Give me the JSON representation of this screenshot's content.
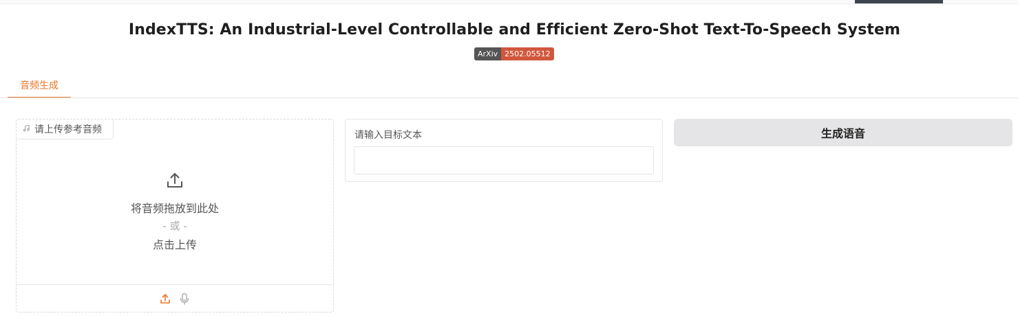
{
  "header": {
    "title": "IndexTTS: An Industrial-Level Controllable and Efficient Zero-Shot Text-To-Speech System",
    "badge_left": "ArXiv",
    "badge_right": "2502.05512"
  },
  "tabs": [
    {
      "label": "音频生成",
      "active": true
    }
  ],
  "audio_upload": {
    "label": "请上传参考音频",
    "drop_text": "将音频拖放到此处",
    "or_text": "- 或 -",
    "click_text": "点击上传",
    "icon": "music-note-icon",
    "footer_icons": [
      "upload-icon",
      "microphone-icon"
    ]
  },
  "text_input": {
    "label": "请输入目标文本",
    "value": "",
    "placeholder": ""
  },
  "generate_button": {
    "label": "生成语音"
  },
  "colors": {
    "accent": "#e8772b",
    "badge_left_bg": "#555555",
    "badge_right_bg": "#d0573d",
    "button_bg": "#e5e5e7"
  }
}
